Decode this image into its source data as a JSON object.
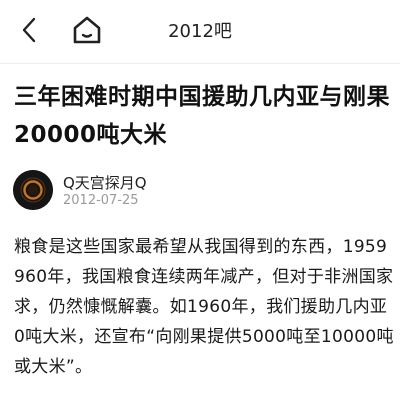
{
  "header": {
    "back_icon": "chevron-left-icon",
    "home_icon": "home-icon",
    "forum_name": "2012吧"
  },
  "article": {
    "title_lines": [
      "三年困难时期中国援助几内亚与刚果",
      "20000吨大米"
    ],
    "author": {
      "name": "Q天宫探月Q",
      "date": "2012-07-25",
      "avatar_icon": "planet-ring-avatar"
    },
    "content_lines": [
      "粮食是这些国家最希望从我国得到的东西，1959",
      "960年，我国粮食连续两年减产，但对于非洲国家",
      "求，仍然慷慨解囊。如1960年，我们援助几内亚",
      "0吨大米，还宣布“向刚果提供5000吨至10000吨",
      "或大米”。"
    ]
  },
  "colors": {
    "background": "#ffffff",
    "text": "#111111",
    "date": "#9a9a9a",
    "avatar_bg": "#151515",
    "avatar_ring": "#c8741f"
  }
}
